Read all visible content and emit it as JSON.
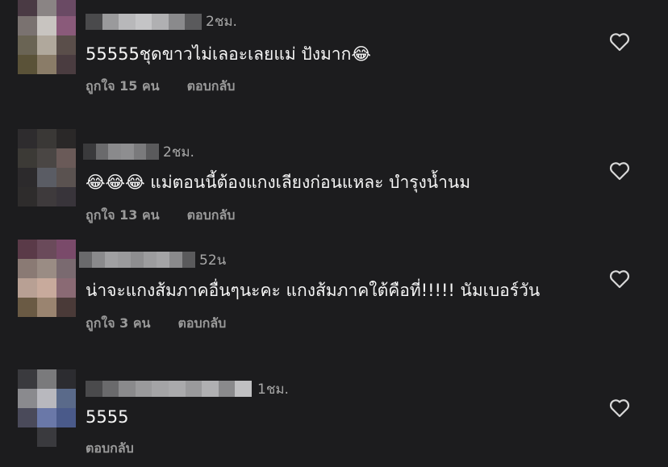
{
  "colors": {
    "background": "#1c1c1e",
    "text_primary": "#f5f5f5",
    "text_secondary": "#9a9a9a",
    "heart_outline": "#d8d8d8"
  },
  "comments": [
    {
      "time": "2ชม.",
      "text": "55555ชุดขาวไม่เลอะเลยแม่ ปังมาก😂",
      "likes": "ถูกใจ 15 คน",
      "reply": "ตอบกลับ",
      "avatar_colors": [
        "#4a3a44",
        "#8a8484",
        "#6a4a64",
        "#7a7270",
        "#c8c4c0",
        "#8a5a7a",
        "#6a6454",
        "#b0a89c",
        "#5a4e4a",
        "#5a5238",
        "#8a7c68",
        "#4a3c40"
      ],
      "username_colors": [
        "#4a4a4c",
        "#9a9a9c",
        "#b8b8ba",
        "#c4c4c6",
        "#b0b0b2",
        "#8a8a8c",
        "#5a5a5c"
      ]
    },
    {
      "time": "2ชม.",
      "text": "😂😂😂 แม่ตอนนี้ต้องแกงเลียงก่อนแหละ บำรุงน้ำนม",
      "likes": "ถูกใจ 13 คน",
      "reply": "ตอบกลับ",
      "avatar_colors": [
        "#2e2c2e",
        "#3a3836",
        "#2a2828",
        "#3c3a36",
        "#4a4644",
        "#6a5a58",
        "#2c2a2c",
        "#5a5c64",
        "#5a5250",
        "#2e2c2c",
        "#3e3a3c",
        "#38343a"
      ],
      "username_colors": [
        "#3a3a3c",
        "#6a6a6c",
        "#8a8a8c",
        "#8e8e90",
        "#7a7a7c",
        "#5a5a5c"
      ]
    },
    {
      "time": "52น",
      "text": "น่าจะแกงส้มภาคอื่นๆนะคะ แกงส้มภาคใต้คือที่!!!!! นัมเบอร์วัน",
      "likes": "ถูกใจ 3 คน",
      "reply": "ตอบกลับ",
      "avatar_colors": [
        "#5a3a48",
        "#6a4a5a",
        "#7a4a6a",
        "#8a7a74",
        "#9a8c84",
        "#7a6a70",
        "#b8a094",
        "#c8aa9c",
        "#8a6a74",
        "#6a5a44",
        "#9a8470",
        "#4a3a38"
      ],
      "username_colors": [
        "#6a6a6c",
        "#8a8a8c",
        "#a0a0a2",
        "#9a9a9c",
        "#8e8e90",
        "#9c9c9e",
        "#a4a4a6",
        "#8a8a8c",
        "#5a5a5c"
      ]
    },
    {
      "time": "1ชม.",
      "text": "5555",
      "likes": "",
      "reply": "ตอบกลับ",
      "avatar_colors": [
        "#3a3a3e",
        "#7a7a7c",
        "#2c2c30",
        "#8a8a8e",
        "#b8b8be",
        "#5a6a8a",
        "#4a4a5a",
        "#6a78a8",
        "#4a5a8a",
        "#1c1c1e",
        "#3a3a3e",
        "#1c1c1e"
      ],
      "username_colors": [
        "#4a4a4c",
        "#6a6a6c",
        "#8a8a8c",
        "#9a9a9c",
        "#a4a4a6",
        "#aaaaac",
        "#9a9a9c",
        "#b0b0b2",
        "#8a8a8c",
        "#c0c0c2"
      ]
    }
  ]
}
